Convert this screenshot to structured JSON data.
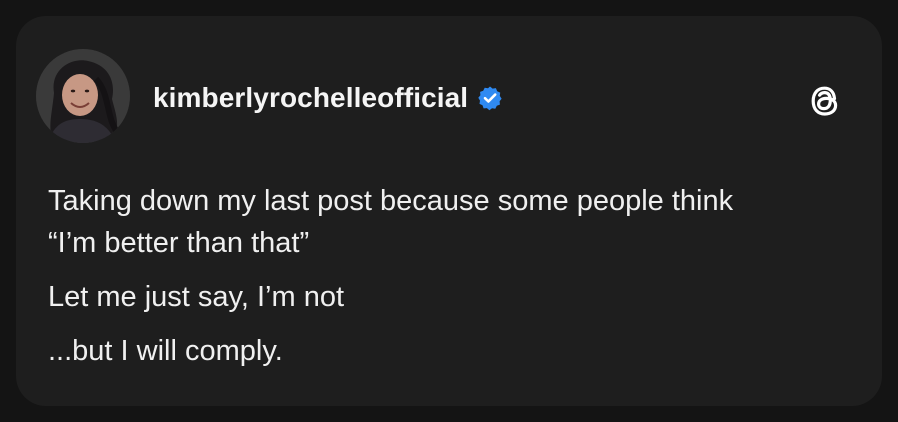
{
  "post": {
    "username": "kimberlyrochelleofficial",
    "verified": true,
    "lines": [
      "Taking down my last post because some people think",
      "“I’m better than that”",
      "Let me just say, I’m not",
      "...but I will comply."
    ]
  },
  "icons": {
    "verified_badge": "verified-check-icon",
    "threads_logo": "threads-logo-icon"
  },
  "colors": {
    "background": "#141414",
    "card": "#1e1e1e",
    "text": "#f0f0f0",
    "verified_blue": "#2f8af2"
  }
}
